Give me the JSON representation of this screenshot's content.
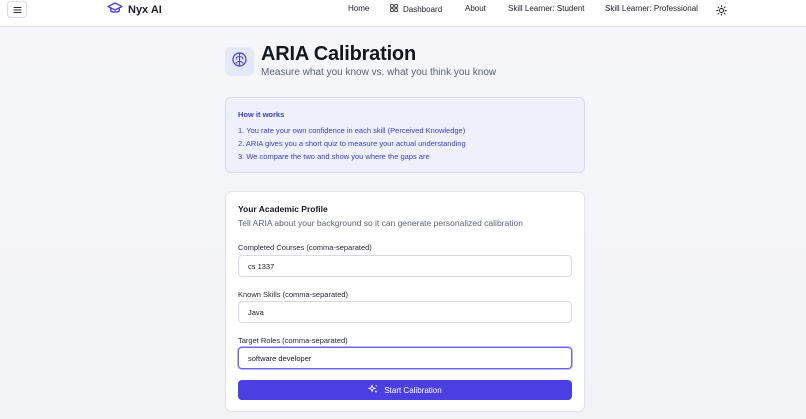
{
  "nav": {
    "brand": "Nyx AI",
    "links": [
      "Home",
      "Dashboard",
      "About",
      "Skill Learner: Student",
      "Skill Learner: Professional"
    ]
  },
  "header": {
    "title": "ARIA Calibration",
    "subtitle": "Measure what you know vs. what you think you know"
  },
  "how_it_works": {
    "title": "How it works",
    "steps": [
      "1. You rate your own confidence in each skill (Perceived Knowledge)",
      "2. ARIA gives you a short quiz to measure your actual understanding",
      "3. We compare the two and show you where the gaps are"
    ]
  },
  "profile": {
    "title": "Your Academic Profile",
    "subtitle": "Tell ARIA about your background so it can generate personalized calibration",
    "fields": [
      {
        "label": "Completed Courses (comma-separated)",
        "value": "cs 1337"
      },
      {
        "label": "Known Skills (comma-separated)",
        "value": "Java"
      },
      {
        "label": "Target Roles (comma-separated)",
        "value": "software developer"
      }
    ],
    "submit_label": "Start Calibration"
  },
  "colors": {
    "accent": "#4a3fe0",
    "info_bg": "#eef0fc",
    "info_text": "#3b3fc0"
  },
  "icons": [
    "menu-icon",
    "graduation-cap-icon",
    "dashboard-grid-icon",
    "sun-icon",
    "brain-icon",
    "sparkles-icon"
  ]
}
